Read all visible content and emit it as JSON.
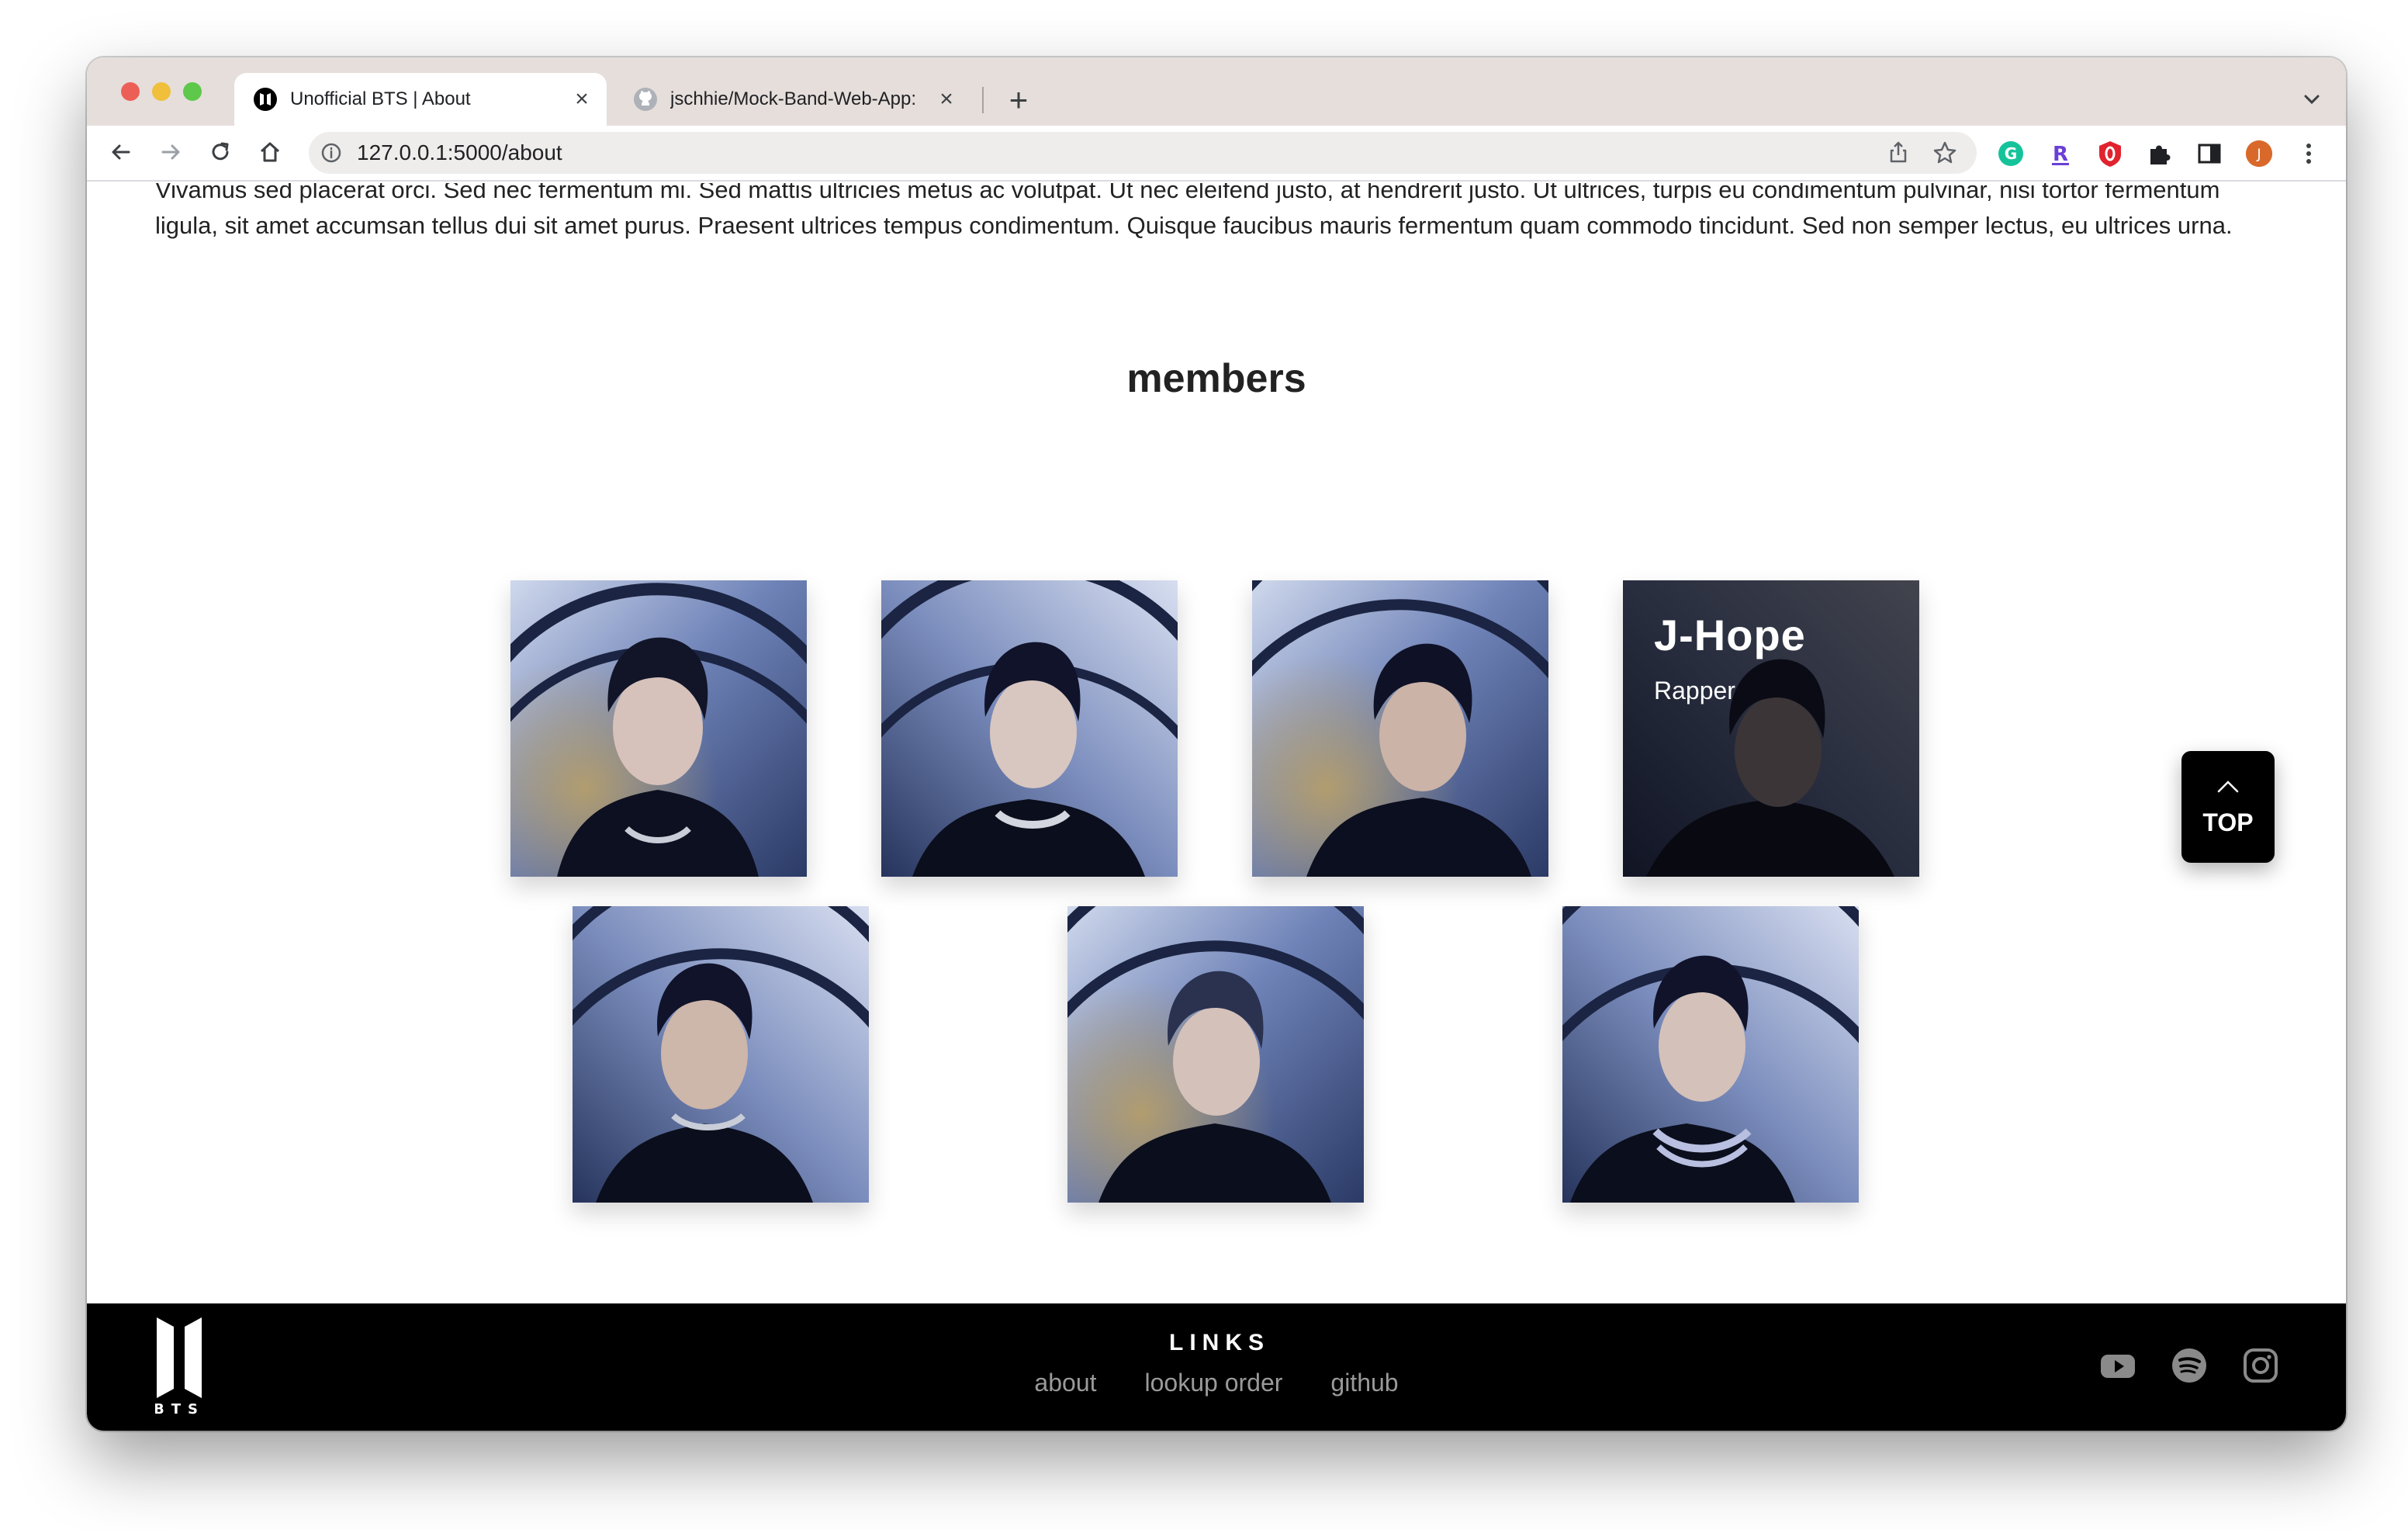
{
  "browser": {
    "tabs": [
      {
        "title": "Unofficial BTS | About",
        "close": "×"
      },
      {
        "title": "jschhie/Mock-Band-Web-App: ",
        "close": "×"
      }
    ],
    "new_tab": "+",
    "url": "127.0.0.1:5000/about",
    "profile_initial": "J",
    "extensions": [
      "grammarly-icon",
      "r-extension-icon",
      "opera-adblock-icon",
      "puzzle-icon",
      "sidebar-icon"
    ]
  },
  "page": {
    "intro_paragraph": "Vivamus sed placerat orci. Sed nec fermentum mi. Sed mattis ultricies metus ac volutpat. Ut nec eleifend justo, at hendrerit justo. Ut ultrices, turpis eu condimentum pulvinar, nisi tortor fermentum ligula, sit amet accumsan tellus dui sit amet purus. Praesent ultrices tempus condimentum. Quisque faucibus mauris fermentum quam commodo tincidunt. Sed non semper lectus, eu ultrices urna.",
    "members_title": "members",
    "hovered_member": {
      "name": "J-Hope",
      "role": "Rapper"
    },
    "top_button": "TOP"
  },
  "footer": {
    "logo_text": "BTS",
    "links_title": "LINKS",
    "links": [
      "about",
      "lookup order",
      "github"
    ],
    "social": [
      "youtube-icon",
      "spotify-icon",
      "instagram-icon"
    ]
  },
  "colors": {
    "tabstrip": "#e5dedb",
    "footer": "#000000",
    "link_gray": "#9a9a9a"
  }
}
